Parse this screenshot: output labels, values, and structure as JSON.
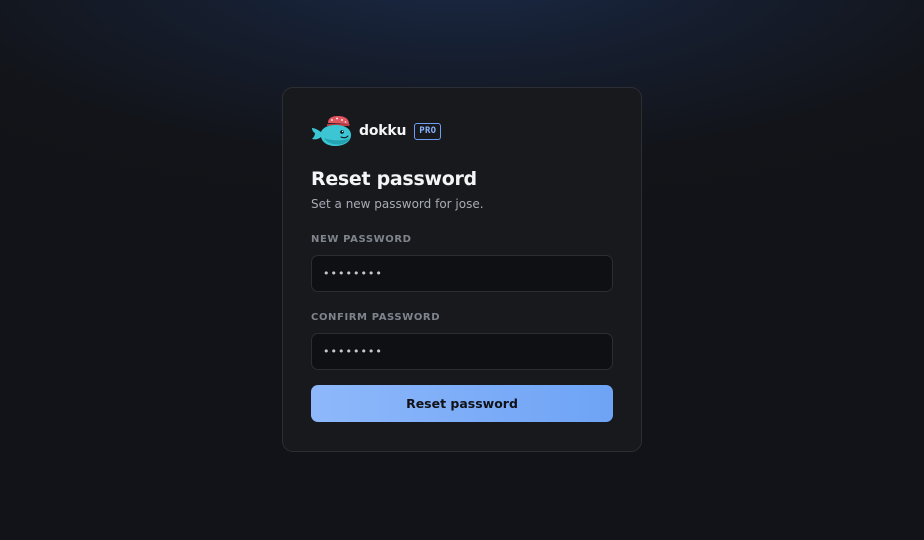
{
  "brand": {
    "name": "dokku",
    "badge": "PRO",
    "logo_icon": "whale-logo-icon"
  },
  "form": {
    "title": "Reset password",
    "subtitle": "Set a new password for jose.",
    "new_password": {
      "label": "NEW PASSWORD",
      "value": "••••••••"
    },
    "confirm_password": {
      "label": "CONFIRM PASSWORD",
      "value": "••••••••"
    },
    "submit_label": "Reset password"
  },
  "colors": {
    "accent": "#7aaaf7",
    "card_background": "#18191d",
    "page_background": "#121318"
  }
}
